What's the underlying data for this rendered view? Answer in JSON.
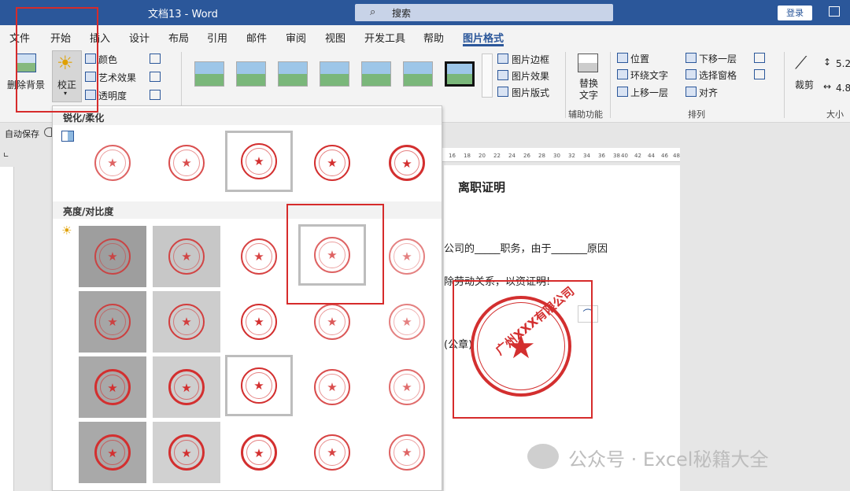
{
  "window": {
    "title": "文档13  -  Word",
    "search_label": "搜索",
    "login_label": "登录"
  },
  "tabs": [
    "文件",
    "开始",
    "插入",
    "设计",
    "布局",
    "引用",
    "邮件",
    "审阅",
    "视图",
    "开发工具",
    "帮助",
    "图片格式"
  ],
  "ribbon": {
    "remove_bg": "删除背景",
    "corrections": "校正",
    "color": "颜色",
    "artistic": "艺术效果",
    "transparency": "透明度",
    "pic_border": "图片边框",
    "pic_effects": "图片效果",
    "pic_layout": "图片版式",
    "alt_text_line1": "替换",
    "alt_text_line2": "文字",
    "accessibility": "辅助功能",
    "position": "位置",
    "wrap_text": "环绕文字",
    "bring_forward": "上移一层",
    "send_backward": "下移一层",
    "selection_pane": "选择窗格",
    "align": "对齐",
    "arrange": "排列",
    "crop": "裁剪",
    "size": "大小",
    "height": "5.2",
    "width": "4.8"
  },
  "autosave": "自动保存",
  "dropdown": {
    "sharpen_title": "锐化/柔化",
    "brightness_title": "亮度/对比度"
  },
  "ruler_numbers": [
    "16",
    "18",
    "20",
    "22",
    "24",
    "26",
    "28",
    "30",
    "32",
    "34",
    "36",
    "38",
    "40",
    "42",
    "44",
    "46",
    "48"
  ],
  "document": {
    "heading": "离职证明",
    "line1": "公司的_____职务，由于_______原因",
    "line2": "除劳动关系，以资证明!",
    "line3": "(公章)",
    "seal_text": "广州XXX有限公司"
  },
  "watermark": "公众号 · Excel秘籍大全",
  "colors": {
    "accent": "#2b579a",
    "seal_red": "#d32f2f",
    "annotation_red": "#d62b2b"
  }
}
